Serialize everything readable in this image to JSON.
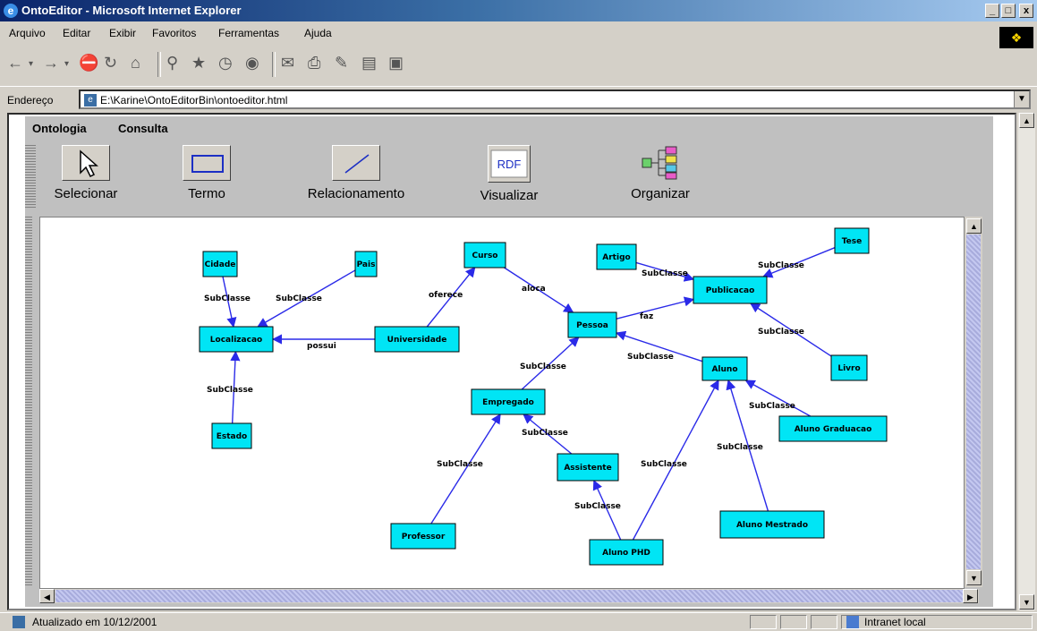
{
  "window": {
    "title": "OntoEditor - Microsoft Internet Explorer",
    "controls": {
      "minimize": "_",
      "maximize": "□",
      "close": "x"
    }
  },
  "menu": {
    "items": [
      {
        "label": "Arquivo"
      },
      {
        "label": "Editar"
      },
      {
        "label": "Exibir"
      },
      {
        "label": "Favoritos"
      },
      {
        "label": "Ferramentas"
      },
      {
        "label": "Ajuda"
      }
    ]
  },
  "address": {
    "label": "Endereço",
    "url": "E:\\Karine\\OntoEditorBin\\ontoeditor.html"
  },
  "applet": {
    "menus": [
      {
        "label": "Ontologia"
      },
      {
        "label": "Consulta"
      }
    ],
    "tools": [
      {
        "label": "Selecionar",
        "icon": "pointer-arrow-icon"
      },
      {
        "label": "Termo",
        "icon": "rectangle-icon"
      },
      {
        "label": "Relacionamento",
        "icon": "line-icon"
      },
      {
        "label": "Visualizar",
        "icon": "rdf-icon",
        "icon_text": "RDF"
      },
      {
        "label": "Organizar",
        "icon": "tree-layout-icon"
      }
    ],
    "graph": {
      "node_color": "#00e5f5",
      "edge_color": "#2a2ae8",
      "nodes": [
        {
          "id": "cidade",
          "label": "Cidade"
        },
        {
          "id": "pais",
          "label": "Pais"
        },
        {
          "id": "localizacao",
          "label": "Localizacao"
        },
        {
          "id": "estado",
          "label": "Estado"
        },
        {
          "id": "universidade",
          "label": "Universidade"
        },
        {
          "id": "curso",
          "label": "Curso"
        },
        {
          "id": "pessoa",
          "label": "Pessoa"
        },
        {
          "id": "artigo",
          "label": "Artigo"
        },
        {
          "id": "publicacao",
          "label": "Publicacao"
        },
        {
          "id": "tese",
          "label": "Tese"
        },
        {
          "id": "livro",
          "label": "Livro"
        },
        {
          "id": "empregado",
          "label": "Empregado"
        },
        {
          "id": "assistente",
          "label": "Assistente"
        },
        {
          "id": "professor",
          "label": "Professor"
        },
        {
          "id": "aluno",
          "label": "Aluno"
        },
        {
          "id": "aluno_graduacao",
          "label": "Aluno Graduacao"
        },
        {
          "id": "aluno_mestrado",
          "label": "Aluno Mestrado"
        },
        {
          "id": "aluno_phd",
          "label": "Aluno PHD"
        }
      ],
      "edges": [
        {
          "from": "cidade",
          "to": "localizacao",
          "label": "SubClasse"
        },
        {
          "from": "pais",
          "to": "localizacao",
          "label": "SubClasse"
        },
        {
          "from": "estado",
          "to": "localizacao",
          "label": "SubClasse"
        },
        {
          "from": "universidade",
          "to": "localizacao",
          "label": "possui"
        },
        {
          "from": "universidade",
          "to": "curso",
          "label": "oferece"
        },
        {
          "from": "curso",
          "to": "pessoa",
          "label": "aloca"
        },
        {
          "from": "pessoa",
          "to": "publicacao",
          "label": "faz"
        },
        {
          "from": "artigo",
          "to": "publicacao",
          "label": "SubClasse"
        },
        {
          "from": "tese",
          "to": "publicacao",
          "label": "SubClasse"
        },
        {
          "from": "livro",
          "to": "publicacao",
          "label": "SubClasse"
        },
        {
          "from": "empregado",
          "to": "pessoa",
          "label": "SubClasse"
        },
        {
          "from": "aluno",
          "to": "pessoa",
          "label": "SubClasse"
        },
        {
          "from": "assistente",
          "to": "empregado",
          "label": "SubClasse"
        },
        {
          "from": "professor",
          "to": "empregado",
          "label": "SubClasse"
        },
        {
          "from": "aluno_graduacao",
          "to": "aluno",
          "label": "SubClasse"
        },
        {
          "from": "aluno_mestrado",
          "to": "aluno",
          "label": "SubClasse"
        },
        {
          "from": "aluno_phd",
          "to": "aluno",
          "label": "SubClasse"
        },
        {
          "from": "aluno_phd",
          "to": "assistente",
          "label": "SubClasse"
        }
      ]
    }
  },
  "status": {
    "text": "Atualizado em 10/12/2001",
    "zone": "Intranet local"
  }
}
